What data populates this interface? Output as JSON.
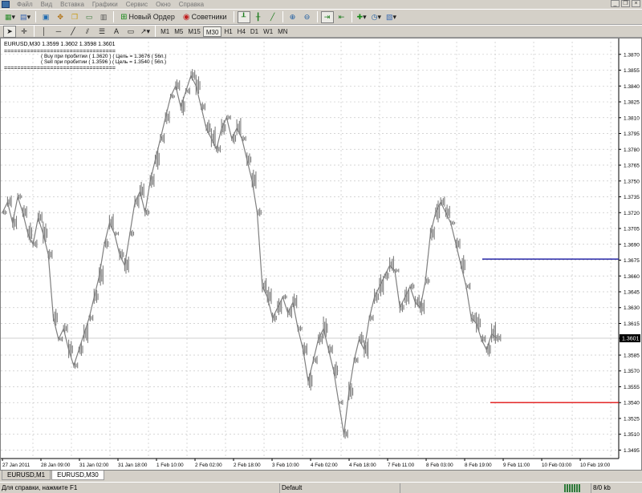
{
  "menu": [
    "Файл",
    "Вид",
    "Вставка",
    "Графики",
    "Сервис",
    "Окно",
    "Справка"
  ],
  "toolbar": {
    "new_order": "Новый Ордер",
    "advisors": "Советники",
    "timeframes": [
      "M1",
      "M5",
      "M15",
      "M30",
      "H1",
      "H4",
      "D1",
      "W1",
      "MN"
    ],
    "active_timeframe": "M30",
    "text_tool": "A"
  },
  "chart": {
    "header": "EURUSD,M30  1.3599 1.3602 1.3598 1.3601",
    "info_separator": "==================================",
    "info_line1": "( Buy при пробитии ( 1.3620 )  ( Цель = 1.3676 ( 56п.)",
    "info_line2": "( Sell  при пробитии ( 1.3596 )  ( Цель = 1.3540 ( 56п.)",
    "current_price": "1.3601",
    "buy_target_color": "#1414a0",
    "sell_target_color": "#e01010",
    "price_color": "#7f7f7f"
  },
  "chart_data": {
    "type": "line",
    "symbol": "EURUSD",
    "timeframe": "M30",
    "ylim": [
      1.3487,
      1.3882
    ],
    "y_ticks": [
      1.387,
      1.3855,
      1.384,
      1.3825,
      1.381,
      1.3795,
      1.378,
      1.3765,
      1.375,
      1.3735,
      1.372,
      1.3705,
      1.369,
      1.3675,
      1.366,
      1.3645,
      1.363,
      1.3615,
      1.3601,
      1.3585,
      1.357,
      1.3555,
      1.354,
      1.3525,
      1.351,
      1.3495
    ],
    "y_tick_labels": [
      "1.3870",
      "1.3855",
      "1.3840",
      "1.3825",
      "1.3810",
      "1.3795",
      "1.3780",
      "1.3765",
      "1.3750",
      "1.3735",
      "1.3720",
      "1.3705",
      "1.3690",
      "1.3675",
      "1.3660",
      "1.3645",
      "1.3630",
      "1.3615",
      "1.3601",
      "1.3585",
      "1.3570",
      "1.3555",
      "1.3540",
      "1.3525",
      "1.3510",
      "1.3495"
    ],
    "x_labels": [
      "27 Jan 2011",
      "28 Jan 09:00",
      "31 Jan 02:00",
      "31 Jan 18:00",
      "1 Feb 10:00",
      "2 Feb 02:00",
      "2 Feb 18:00",
      "3 Feb 10:00",
      "4 Feb 02:00",
      "4 Feb 18:00",
      "7 Feb 11:00",
      "8 Feb 03:00",
      "8 Feb 19:00",
      "9 Feb 11:00",
      "10 Feb 03:00",
      "10 Feb 19:00"
    ],
    "series": [
      {
        "values": [
          1.372,
          1.373,
          1.371,
          1.3735,
          1.372,
          1.37,
          1.369,
          1.3715,
          1.37,
          1.368,
          1.362,
          1.36,
          1.361,
          1.359,
          1.3575,
          1.359,
          1.3605,
          1.362,
          1.364,
          1.366,
          1.369,
          1.371,
          1.37,
          1.368,
          1.367,
          1.37,
          1.373,
          1.374,
          1.372,
          1.375,
          1.377,
          1.379,
          1.381,
          1.383,
          1.384,
          1.382,
          1.3835,
          1.385,
          1.384,
          1.382,
          1.38,
          1.379,
          1.378,
          1.38,
          1.381,
          1.379,
          1.38,
          1.379,
          1.377,
          1.375,
          1.372,
          1.365,
          1.364,
          1.362,
          1.363,
          1.364,
          1.3625,
          1.3635,
          1.361,
          1.359,
          1.356,
          1.358,
          1.36,
          1.361,
          1.359,
          1.357,
          1.354,
          1.351,
          1.355,
          1.358,
          1.36,
          1.359,
          1.362,
          1.364,
          1.365,
          1.366,
          1.367,
          1.3665,
          1.363,
          1.364,
          1.365,
          1.3635,
          1.363,
          1.3655,
          1.37,
          1.372,
          1.373,
          1.372,
          1.371,
          1.369,
          1.367,
          1.365,
          1.362,
          1.3615,
          1.36,
          1.359,
          1.3605,
          1.3601
        ]
      }
    ],
    "horizontal_lines": [
      {
        "value": 1.3676,
        "color": "#1414a0"
      },
      {
        "value": 1.354,
        "color": "#e01010"
      }
    ]
  },
  "tabs": [
    "EURUSD,M1",
    "EURUSD,M30"
  ],
  "active_tab": "EURUSD,M30",
  "status": {
    "help": "Для справки, нажмите F1",
    "profile": "Default",
    "traffic": "8/0 kb"
  }
}
